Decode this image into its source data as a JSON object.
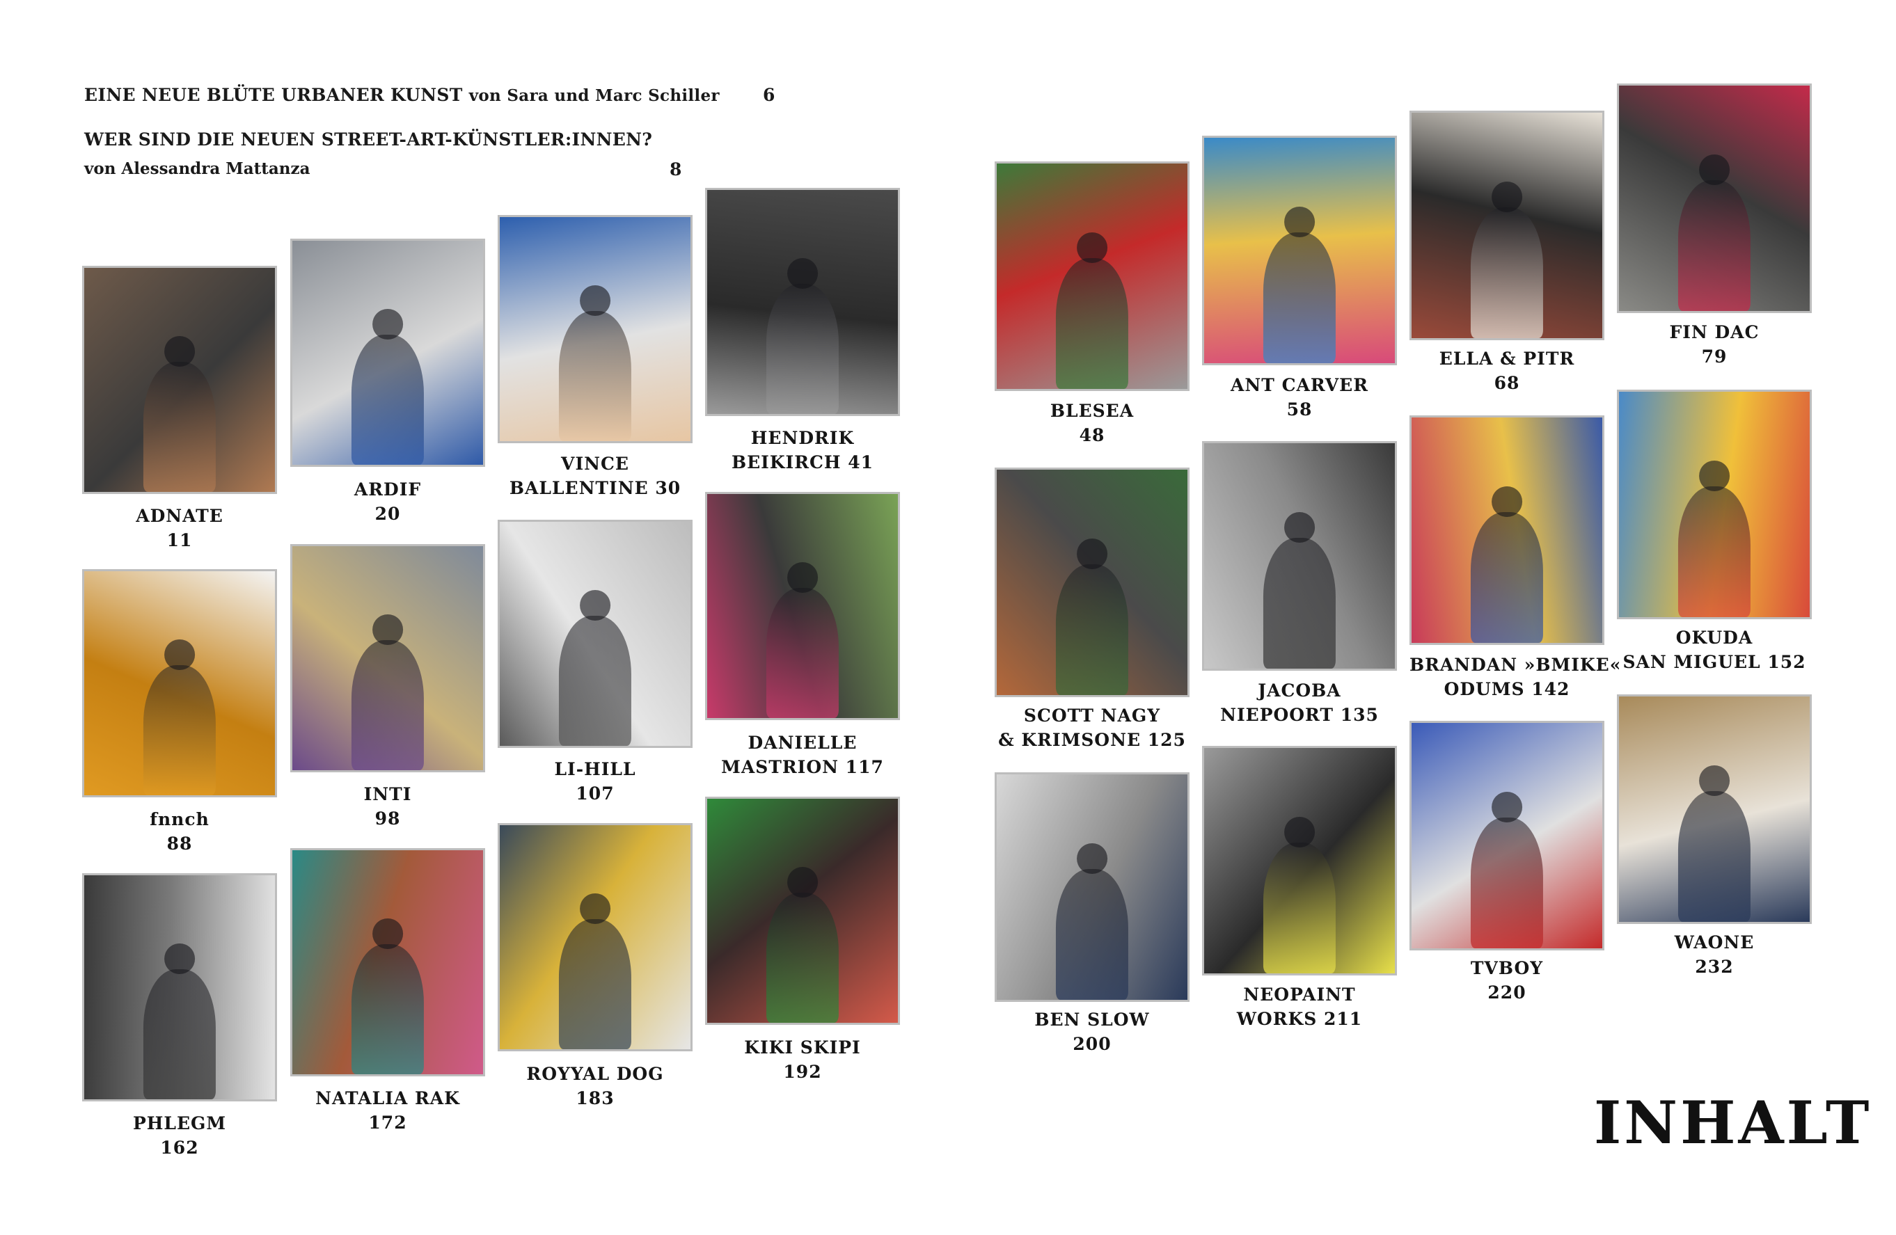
{
  "intro": {
    "essay1_title": "EINE NEUE BLÜTE URBANER KUNST",
    "essay1_author": "von Sara und Marc Schiller",
    "essay1_page": "6",
    "essay2_title": "WER SIND DIE NEUEN STREET-ART-KÜNSTLER:INNEN?",
    "essay2_author": "von Alessandra Mattanza",
    "essay2_page": "8"
  },
  "contents_title": "INHALT",
  "artists": [
    {
      "lines": [
        "ADNATE",
        "11"
      ],
      "colors": [
        "#6e5a4a",
        "#b07a52",
        "#3a3a3a"
      ]
    },
    {
      "lines": [
        "ARDIF",
        "20"
      ],
      "colors": [
        "#8a8f96",
        "#2f5aa8",
        "#d9d9d9"
      ]
    },
    {
      "lines": [
        "VINCE",
        "BALLENTINE 30"
      ],
      "colors": [
        "#2d5fae",
        "#e7c6a3",
        "#e2e2e2"
      ]
    },
    {
      "lines": [
        "HENDRIK",
        "BEIKIRCH 41"
      ],
      "colors": [
        "#4a4a4a",
        "#9a9a9a",
        "#2a2a2a"
      ]
    },
    {
      "lines": [
        "fnnch",
        "88"
      ],
      "colors": [
        "#f4f4f4",
        "#e09a22",
        "#c47f12"
      ]
    },
    {
      "lines": [
        "INTI",
        "98"
      ],
      "colors": [
        "#7f8a9a",
        "#6b4a8a",
        "#c9b27a"
      ]
    },
    {
      "lines": [
        "LI-HILL",
        "107"
      ],
      "colors": [
        "#bdbdbd",
        "#5a5a5a",
        "#e6e6e6"
      ]
    },
    {
      "lines": [
        "DANIELLE",
        "MASTRION 117"
      ],
      "colors": [
        "#7aa356",
        "#c83a6a",
        "#3a3a3a"
      ]
    },
    {
      "lines": [
        "PHLEGM",
        "162"
      ],
      "colors": [
        "#e4e4e4",
        "#3a3a3a",
        "#7a7a7a"
      ]
    },
    {
      "lines": [
        "NATALIA RAK",
        "172"
      ],
      "colors": [
        "#d05a8a",
        "#2a8a86",
        "#a35a3a"
      ]
    },
    {
      "lines": [
        "ROYYAL DOG",
        "183"
      ],
      "colors": [
        "#e6e6e6",
        "#3a4a5a",
        "#d8b23a"
      ]
    },
    {
      "lines": [
        "KIKI SKIPI",
        "192"
      ],
      "colors": [
        "#d45a4a",
        "#2f8a3a",
        "#3a2a2a"
      ]
    },
    {
      "lines": [
        "BLESEA",
        "48"
      ],
      "colors": [
        "#9a9a9a",
        "#3d7a3a",
        "#c42a2a"
      ]
    },
    {
      "lines": [
        "ANT CARVER",
        "58"
      ],
      "colors": [
        "#d84a7a",
        "#3a8ac8",
        "#e8c04a"
      ]
    },
    {
      "lines": [
        "ELLA & PITR",
        "68"
      ],
      "colors": [
        "#9a4a3a",
        "#e8e2d8",
        "#2a2a2a"
      ]
    },
    {
      "lines": [
        "FIN DAC",
        "79"
      ],
      "colors": [
        "#8a8a86",
        "#c42a4a",
        "#3a3a3a"
      ]
    },
    {
      "lines": [
        "SCOTT NAGY",
        "& KRIMSONE 125"
      ],
      "colors": [
        "#b4683a",
        "#3a6a3a",
        "#4a4a4a"
      ]
    },
    {
      "lines": [
        "JACOBA",
        "NIEPOORT 135"
      ],
      "colors": [
        "#c8c8c8",
        "#3a3a3a",
        "#8a8a8a"
      ]
    },
    {
      "lines": [
        "BRANDAN »BMIKE«",
        "ODUMS 142"
      ],
      "colors": [
        "#c83a5a",
        "#3a5aa8",
        "#e8c04a"
      ]
    },
    {
      "lines": [
        "OKUDA",
        "SAN MIGUEL 152"
      ],
      "colors": [
        "#4a8ac8",
        "#d84a3a",
        "#f0c03a"
      ]
    },
    {
      "lines": [
        "BEN SLOW",
        "200"
      ],
      "colors": [
        "#d8d8d8",
        "#2a3a5a",
        "#8a8a8a"
      ]
    },
    {
      "lines": [
        "NEOPAINT",
        "WORKS 211"
      ],
      "colors": [
        "#9a9a9a",
        "#e8e04a",
        "#2a2a2a"
      ]
    },
    {
      "lines": [
        "TVBOY",
        "220"
      ],
      "colors": [
        "#3a5ab8",
        "#c42a2a",
        "#e0e0e0"
      ]
    },
    {
      "lines": [
        "WAONE",
        "232"
      ],
      "colors": [
        "#a88a5a",
        "#2a3a5a",
        "#e8e2d8"
      ]
    }
  ]
}
